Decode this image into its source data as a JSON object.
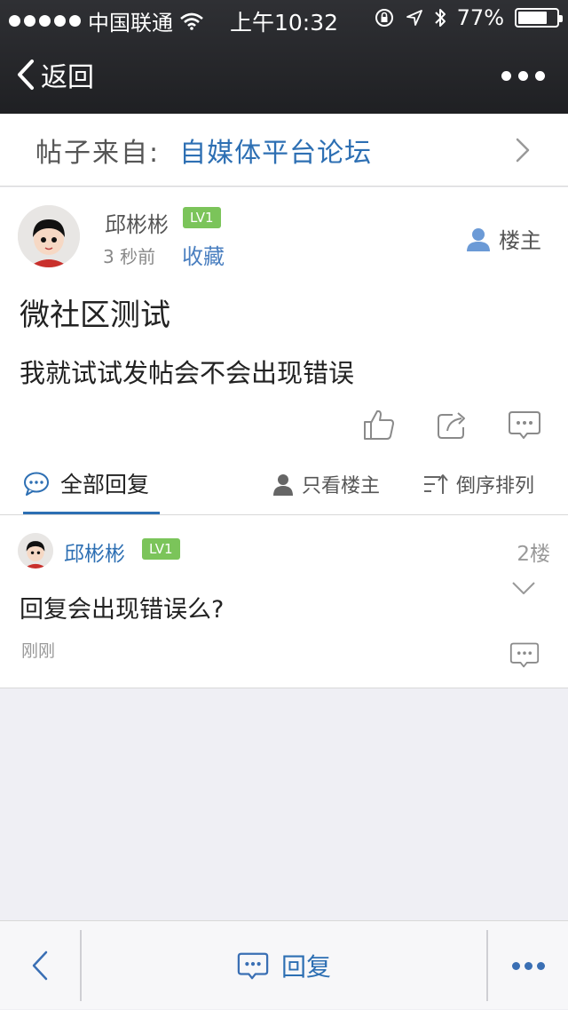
{
  "status_bar": {
    "carrier": "中国联通",
    "time": "上午10:32",
    "battery": "77%",
    "battery_level": 0.77
  },
  "nav": {
    "back_label": "返回"
  },
  "source": {
    "label": "帖子来自:",
    "forum": "自媒体平台论坛"
  },
  "post": {
    "author": "邱彬彬",
    "level": "LV1",
    "time": "3 秒前",
    "collect_label": "收藏",
    "owner_label": "楼主",
    "title": "微社区测试",
    "body": "我就试试发帖会不会出现错误"
  },
  "tabs": {
    "all_replies": "全部回复",
    "owner_only": "只看楼主",
    "reverse_order": "倒序排列"
  },
  "reply": {
    "author": "邱彬彬",
    "level": "LV1",
    "floor": "2楼",
    "text": "回复会出现错误么?",
    "time": "刚刚"
  },
  "toolbar": {
    "reply_label": "回复"
  },
  "colors": {
    "accent": "#2d6fb3",
    "level_badge": "#7bc45a",
    "nav_bg": "#28292d"
  }
}
